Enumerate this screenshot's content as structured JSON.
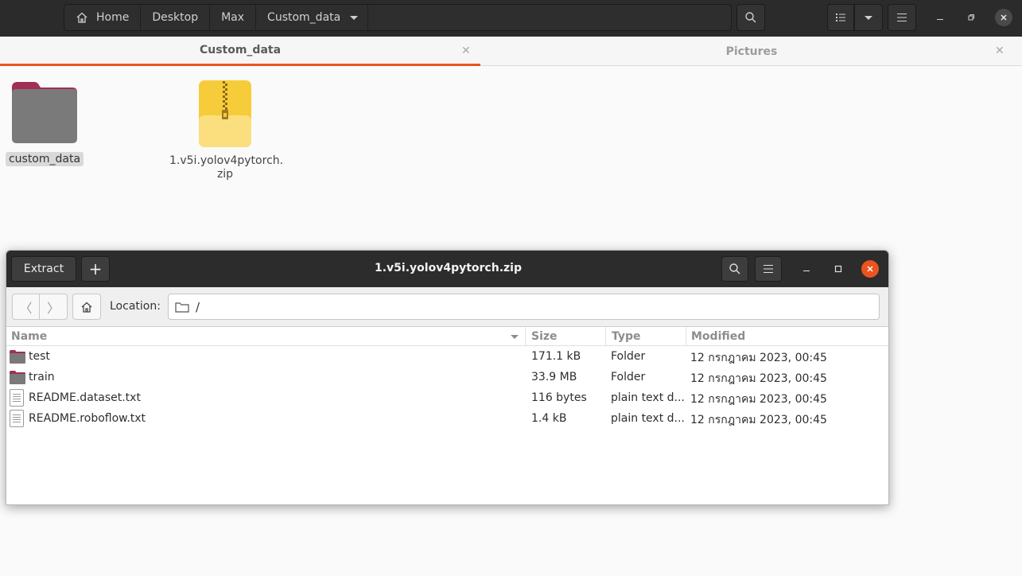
{
  "header": {
    "path": [
      {
        "label": "Home",
        "icon": "home-icon"
      },
      {
        "label": "Desktop"
      },
      {
        "label": "Max"
      },
      {
        "label": "Custom_data"
      }
    ]
  },
  "tabs": [
    {
      "label": "Custom_data",
      "active": true
    },
    {
      "label": "Pictures",
      "active": false
    }
  ],
  "files": [
    {
      "name": "custom_data",
      "type": "folder"
    },
    {
      "name_line1": "1.v5i.yolov4pytorch.",
      "name_line2": "zip",
      "type": "zip"
    }
  ],
  "archive": {
    "extract_label": "Extract",
    "add_label": "+",
    "title": "1.v5i.yolov4pytorch.zip",
    "location_label": "Location:",
    "location_value": "/",
    "columns": {
      "name": "Name",
      "size": "Size",
      "type": "Type",
      "modified": "Modified"
    },
    "rows": [
      {
        "name": "test",
        "icon": "folder-icon",
        "size": "171.1 kB",
        "type": "Folder",
        "modified": "12 กรกฎาคม 2023, 00:45"
      },
      {
        "name": "train",
        "icon": "folder-icon",
        "size": "33.9 MB",
        "type": "Folder",
        "modified": "12 กรกฎาคม 2023, 00:45"
      },
      {
        "name": "README.dataset.txt",
        "icon": "text-file-icon",
        "size": "116 bytes",
        "type": "plain text d...",
        "modified": "12 กรกฎาคม 2023, 00:45"
      },
      {
        "name": "README.roboflow.txt",
        "icon": "text-file-icon",
        "size": "1.4 kB",
        "type": "plain text d...",
        "modified": "12 กรกฎาคม 2023, 00:45"
      }
    ]
  },
  "colors": {
    "accent": "#e95420",
    "close_button": "#e95420",
    "folder_top": "#a03055",
    "folder_body": "#7a7a7a",
    "zip": "#f7cc3a"
  }
}
